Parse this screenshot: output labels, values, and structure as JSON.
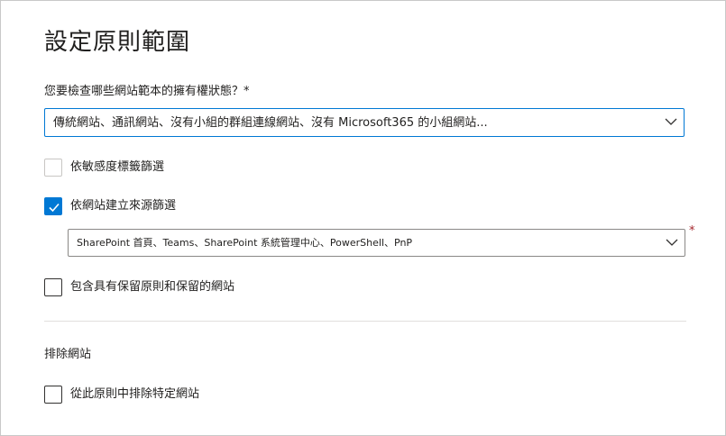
{
  "page": {
    "title": "設定原則範圍"
  },
  "ownership": {
    "question": "您要檢查哪些網站範本的擁有權狀態？*",
    "selected": "傳統網站、通訊網站、沒有小組的群組連線網站、沒有 Microsoft365 的小組網站..."
  },
  "filters": {
    "sensitivity": {
      "label": "依敏感度標籤篩選",
      "checked": false
    },
    "source": {
      "label": "依網站建立來源篩選",
      "checked": true
    },
    "source_selected": "SharePoint 首頁、Teams、SharePoint 系統管理中心、PowerShell、PnP",
    "required_mark": "*",
    "retention": {
      "label": "包含具有保留原則和保留的網站",
      "checked": false
    }
  },
  "exclude": {
    "heading": "排除網站",
    "exclude_specific": {
      "label": "從此原則中排除特定網站",
      "checked": false
    }
  },
  "colors": {
    "accent": "#0078d4",
    "text": "#201f1e",
    "required": "#a4262c"
  },
  "icons": {
    "dropdown": "chevron-down-icon",
    "check": "checkmark-icon"
  }
}
